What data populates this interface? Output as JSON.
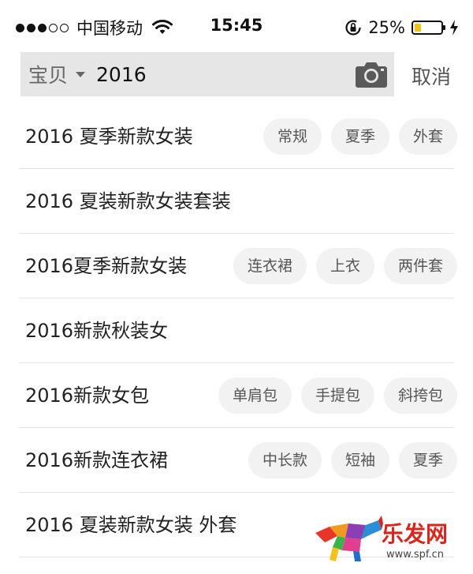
{
  "status_bar": {
    "carrier": "中国移动",
    "time": "15:45",
    "battery_percent": "25%",
    "battery_level": 0.25,
    "signal_bars_filled": 3,
    "signal_bars_total": 5,
    "icons": [
      "signal-dots-icon",
      "wifi-icon",
      "rotation-lock-icon",
      "battery-icon",
      "charging-bolt-icon"
    ]
  },
  "search": {
    "scope": "宝贝",
    "query": "2016",
    "cancel_label": "取消",
    "camera_icon": "camera-icon",
    "background_color": "#e6e6e6"
  },
  "suggestions": [
    {
      "text": "2016 夏季新款女装",
      "tags": [
        "常规",
        "夏季",
        "外套"
      ]
    },
    {
      "text": "2016 夏装新款女装套装",
      "tags": []
    },
    {
      "text": "2016夏季新款女装",
      "tags": [
        "连衣裙",
        "上衣",
        "两件套"
      ]
    },
    {
      "text": "2016新款秋装女",
      "tags": []
    },
    {
      "text": "2016新款女包",
      "tags": [
        "单肩包",
        "手提包",
        "斜挎包"
      ]
    },
    {
      "text": "2016新款连衣裙",
      "tags": [
        "中长款",
        "短袖",
        "夏季"
      ]
    },
    {
      "text": "2016 夏装新款女装 外套",
      "tags": []
    }
  ],
  "watermark": {
    "title": "乐发网",
    "url": "www.spf.cn"
  },
  "colors": {
    "chip_background": "#f2f2f2",
    "battery_fill": "#f2c21b",
    "watermark_red": "#d9261c"
  }
}
